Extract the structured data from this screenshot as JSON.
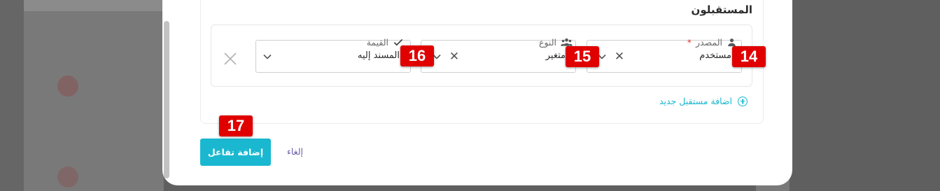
{
  "section": {
    "title": "المستقبلون"
  },
  "fields": {
    "source": {
      "label": "المصدر",
      "required_mark": "*",
      "value": "مستخدم",
      "icon": "person-icon"
    },
    "type": {
      "label": "النوع",
      "value": "متغير",
      "icon": "group-icon"
    },
    "value": {
      "label": "القيمة",
      "value": "المسند إليه",
      "icon": "check-icon"
    }
  },
  "add_receiver": {
    "label": "اضافة مستقبل جديد"
  },
  "actions": {
    "submit_label": "إضافة تفاعل",
    "cancel_label": "إلغاء"
  },
  "badges": {
    "b14": "14",
    "b15": "15",
    "b16": "16",
    "b17": "17"
  },
  "colors": {
    "accent": "#1ab8d0",
    "badge": "#e00000",
    "required": "#e53935",
    "cancel": "#6b5ca8"
  }
}
